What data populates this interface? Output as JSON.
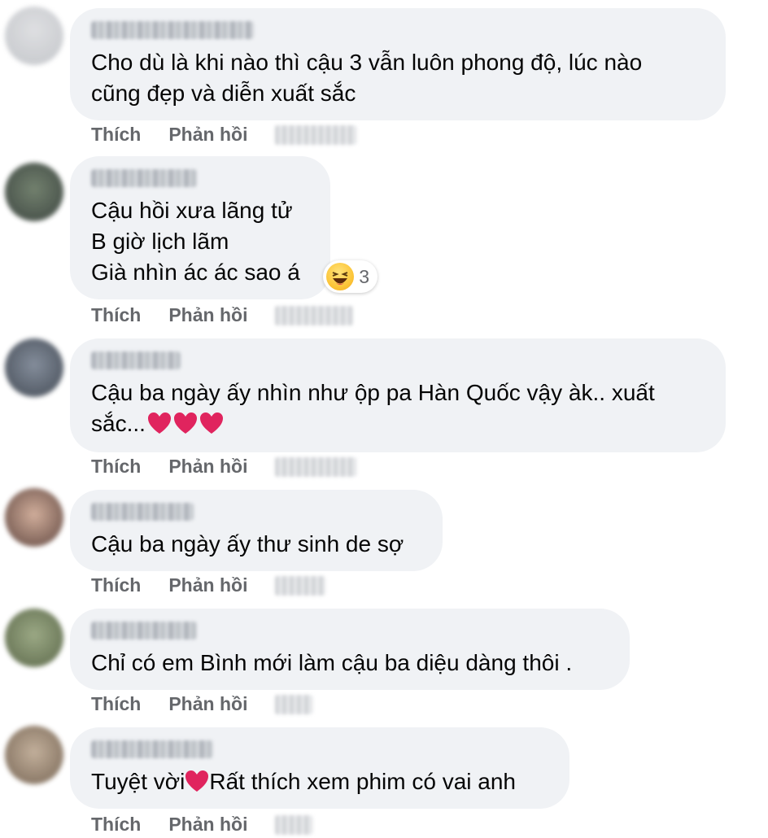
{
  "action_labels": {
    "like": "Thích",
    "reply": "Phản hồi"
  },
  "comments": [
    {
      "text": "Cho dù là khi nào thì cậu 3 vẫn luôn phong độ, lúc nào\ncũng đẹp và diễn xuất sắc"
    },
    {
      "text": "Cậu hồi xưa lãng tử\nB giờ lịch lãm\nGià nhìn ác ác sao á",
      "reaction": {
        "icon": "haha-emoji-icon",
        "count": "3"
      }
    },
    {
      "text_before_hearts": "Cậu ba ngày ấy nhìn như ộp pa Hàn Quốc vậy àk.. xuất\nsắc...",
      "hearts": 3
    },
    {
      "text": "Cậu ba ngày ấy thư sinh de sợ"
    },
    {
      "text": "Chỉ có em Bình mới làm cậu ba diệu dàng thôi ."
    },
    {
      "text_before_heart": "Tuyệt vời",
      "text_after_heart": "Rất thích xem phim có vai anh"
    }
  ],
  "colors": {
    "bubble": "#f0f2f5",
    "action_text": "#65676b",
    "heart": "#e0245e"
  }
}
